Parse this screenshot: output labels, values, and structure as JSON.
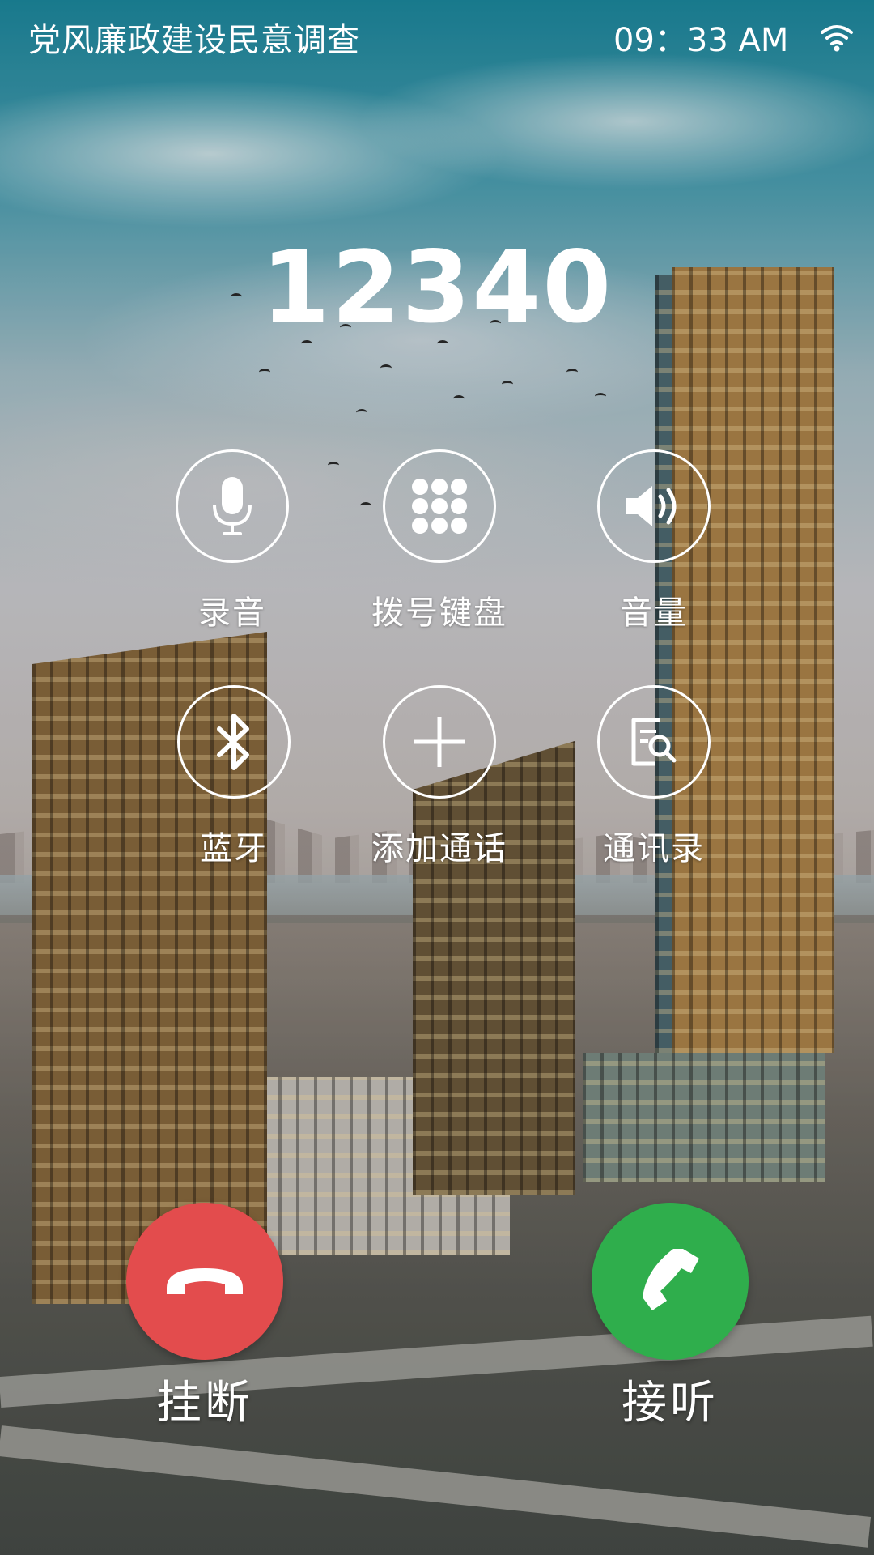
{
  "status_bar": {
    "title": "党风廉政建设民意调查",
    "time": "09：33 AM",
    "wifi_icon": "wifi-icon"
  },
  "call": {
    "number": "12340"
  },
  "actions": [
    {
      "label": "录音",
      "icon": "microphone-icon"
    },
    {
      "label": "拨号键盘",
      "icon": "dialpad-icon"
    },
    {
      "label": "音量",
      "icon": "speaker-icon"
    },
    {
      "label": "蓝牙",
      "icon": "bluetooth-icon"
    },
    {
      "label": "添加通话",
      "icon": "plus-icon"
    },
    {
      "label": "通讯录",
      "icon": "contacts-icon"
    }
  ],
  "controls": {
    "hangup_label": "挂断",
    "hangup_color": "#e34c4d",
    "answer_label": "接听",
    "answer_color": "#2fae4c"
  }
}
